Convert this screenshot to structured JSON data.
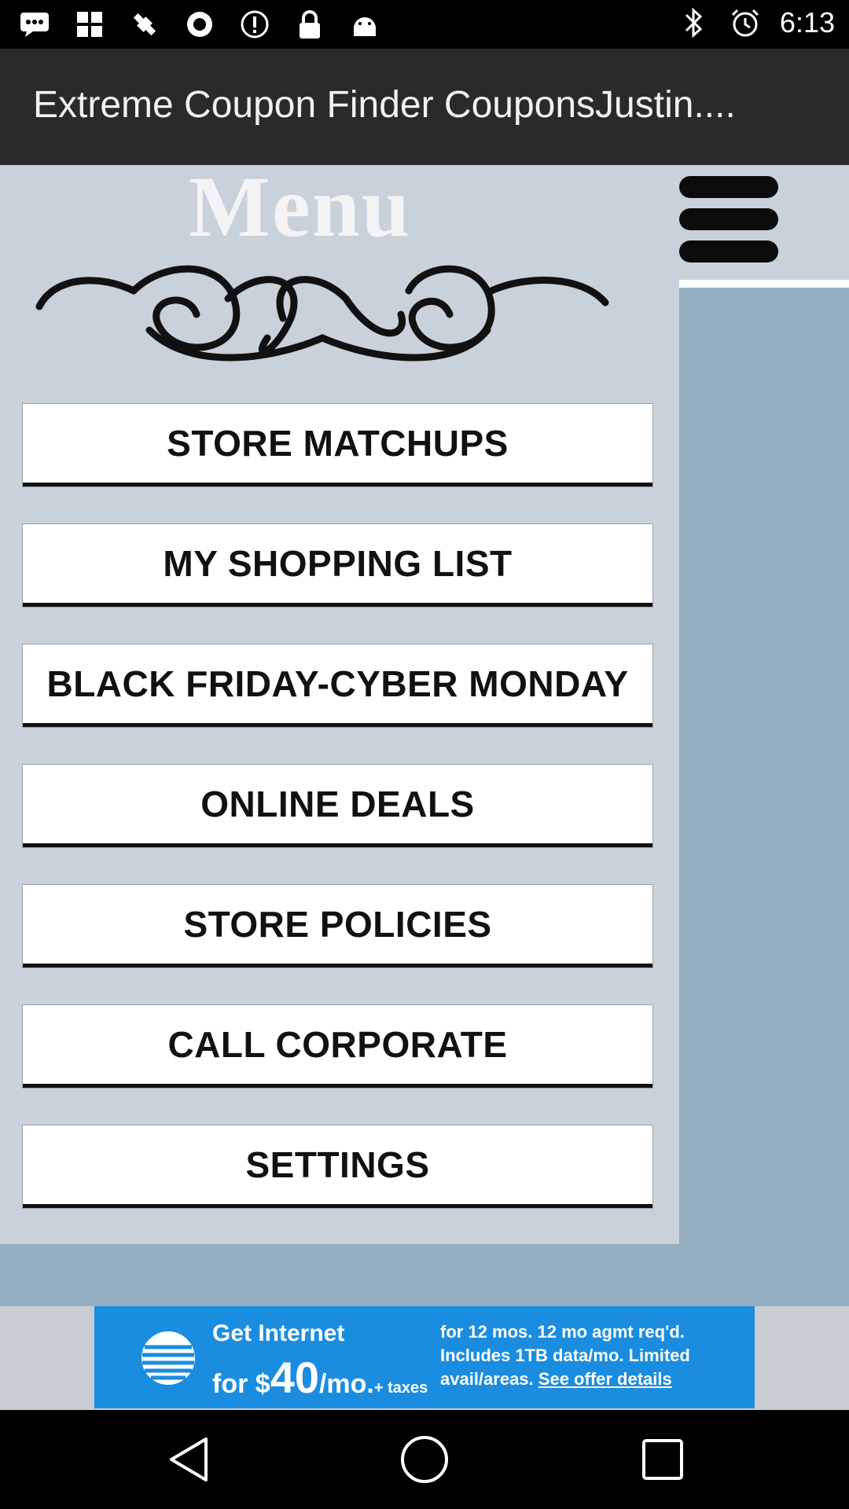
{
  "status_bar": {
    "time": "6:13",
    "left_icons": [
      "messages-icon",
      "grid-icon",
      "fake-gps-icon",
      "location-icon",
      "info-icon",
      "lock-icon",
      "android-icon"
    ],
    "right_icons": [
      "bluetooth-icon",
      "alarm-icon"
    ]
  },
  "app_bar": {
    "title": "Extreme Coupon Finder CouponsJustin...."
  },
  "menu": {
    "heading": "Menu",
    "items": [
      {
        "label": "STORE MATCHUPS"
      },
      {
        "label": "MY SHOPPING LIST"
      },
      {
        "label": "BLACK FRIDAY-CYBER MONDAY"
      },
      {
        "label": "ONLINE DEALS"
      },
      {
        "label": "STORE POLICIES"
      },
      {
        "label": "CALL CORPORATE"
      },
      {
        "label": "SETTINGS"
      }
    ]
  },
  "ad": {
    "line1": "Get Internet",
    "line2_prefix": "for $",
    "line2_number": "40",
    "line2_suffix": "/mo.",
    "line2_note": "+ taxes",
    "small_line1": "for 12 mos. 12 mo agmt req'd.",
    "small_line2": "Includes 1TB data/mo. Limited",
    "small_line3": "avail/areas.",
    "link_text": "See offer details"
  },
  "colors": {
    "app_bar": "#2a2a2a",
    "panel": "#c9d1db",
    "background": "#94adc1",
    "ad": "#1a8de0"
  }
}
